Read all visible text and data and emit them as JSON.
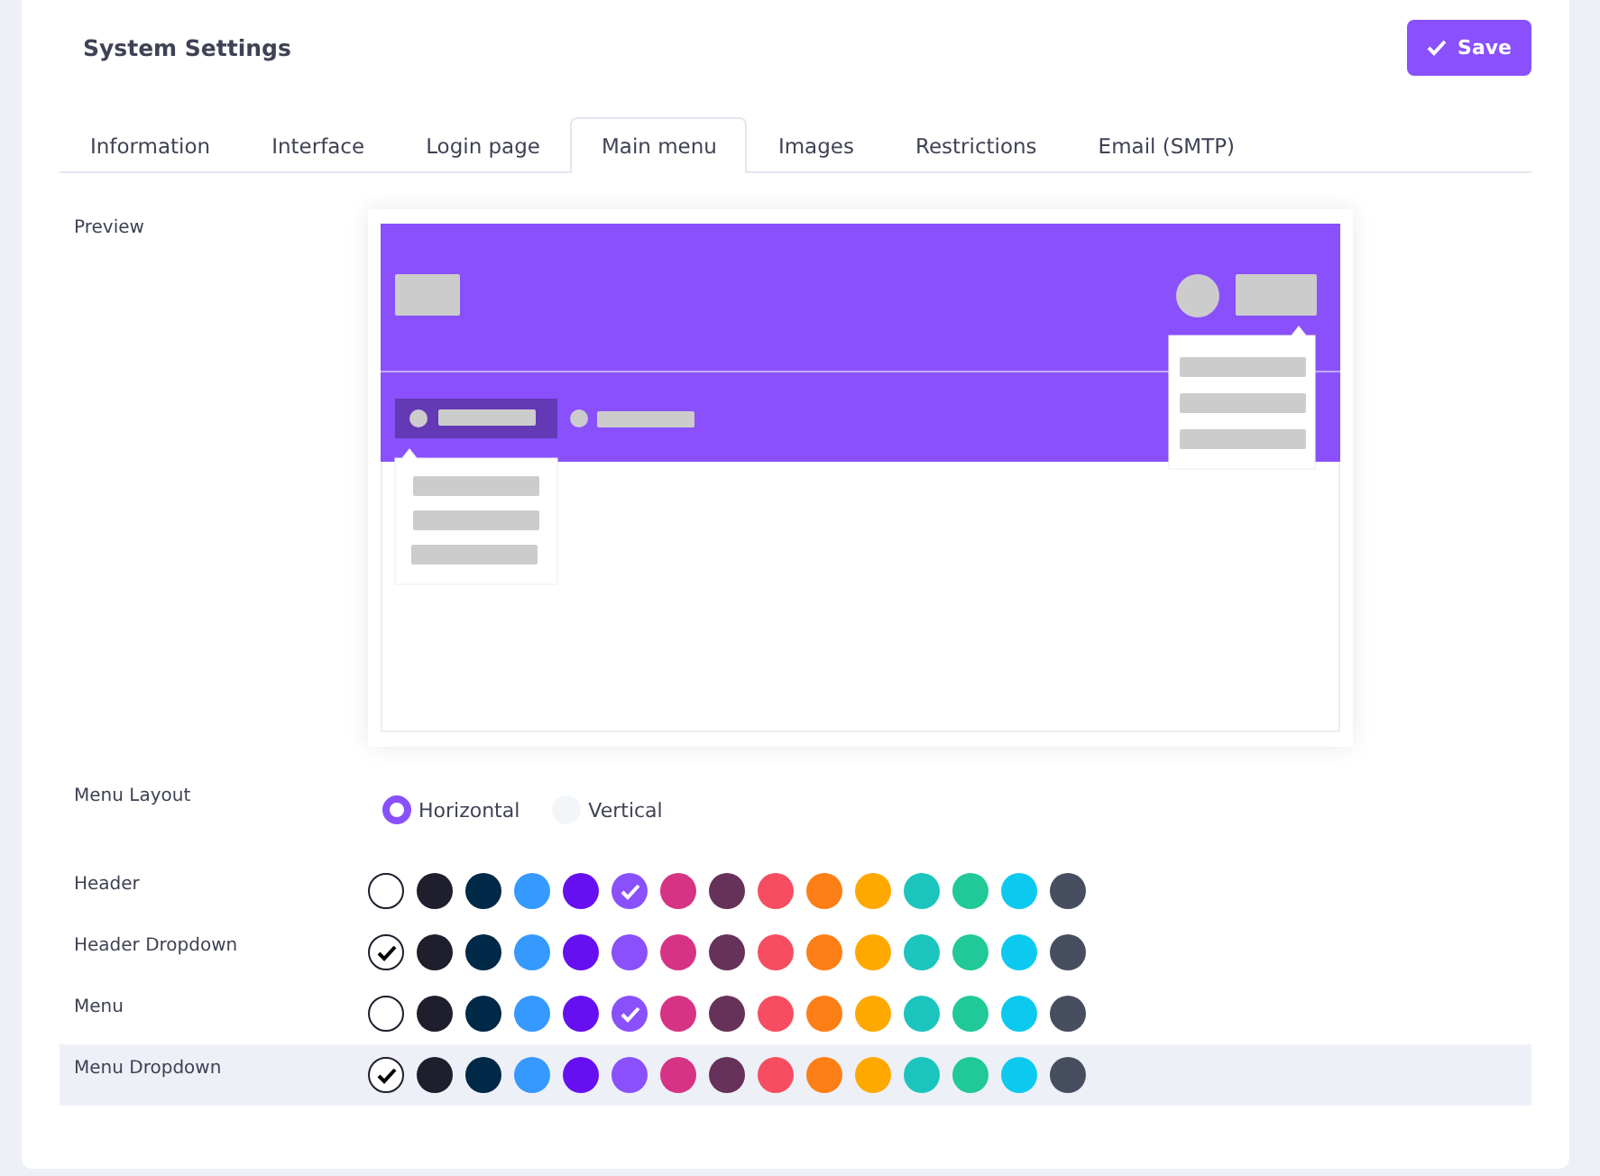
{
  "title": "System Settings",
  "save_button": {
    "label": "Save"
  },
  "tabs": [
    {
      "label": "Information",
      "selected": false
    },
    {
      "label": "Interface",
      "selected": false
    },
    {
      "label": "Login page",
      "selected": false
    },
    {
      "label": "Main menu",
      "selected": true
    },
    {
      "label": "Images",
      "selected": false
    },
    {
      "label": "Restrictions",
      "selected": false
    },
    {
      "label": "Email (SMTP)",
      "selected": false
    }
  ],
  "preview": {
    "label": "Preview"
  },
  "menu_layout": {
    "label": "Menu Layout",
    "options": [
      {
        "label": "Horizontal",
        "selected": true
      },
      {
        "label": "Vertical",
        "selected": false
      }
    ]
  },
  "palettes": [
    {
      "label": "Header",
      "highlighted": false,
      "swatches": [
        {
          "color": "#ffffff",
          "selected": false
        },
        {
          "color": "#1e1e2d",
          "selected": false
        },
        {
          "color": "#002847",
          "selected": false
        },
        {
          "color": "#3699ff",
          "selected": false
        },
        {
          "color": "#6610f2",
          "selected": false
        },
        {
          "color": "#8950fc",
          "selected": true
        },
        {
          "color": "#d63384",
          "selected": false
        },
        {
          "color": "#663259",
          "selected": false
        },
        {
          "color": "#f64e60",
          "selected": false
        },
        {
          "color": "#fd7e14",
          "selected": false
        },
        {
          "color": "#ffa800",
          "selected": false
        },
        {
          "color": "#1bc5bd",
          "selected": false
        },
        {
          "color": "#20c997",
          "selected": false
        },
        {
          "color": "#0bc9ef",
          "selected": false
        },
        {
          "color": "#464e5f",
          "selected": false
        }
      ]
    },
    {
      "label": "Header Dropdown",
      "highlighted": false,
      "swatches": [
        {
          "color": "#ffffff",
          "selected": true
        },
        {
          "color": "#1e1e2d",
          "selected": false
        },
        {
          "color": "#002847",
          "selected": false
        },
        {
          "color": "#3699ff",
          "selected": false
        },
        {
          "color": "#6610f2",
          "selected": false
        },
        {
          "color": "#8950fc",
          "selected": false
        },
        {
          "color": "#d63384",
          "selected": false
        },
        {
          "color": "#663259",
          "selected": false
        },
        {
          "color": "#f64e60",
          "selected": false
        },
        {
          "color": "#fd7e14",
          "selected": false
        },
        {
          "color": "#ffa800",
          "selected": false
        },
        {
          "color": "#1bc5bd",
          "selected": false
        },
        {
          "color": "#20c997",
          "selected": false
        },
        {
          "color": "#0bc9ef",
          "selected": false
        },
        {
          "color": "#464e5f",
          "selected": false
        }
      ]
    },
    {
      "label": "Menu",
      "highlighted": false,
      "swatches": [
        {
          "color": "#ffffff",
          "selected": false
        },
        {
          "color": "#1e1e2d",
          "selected": false
        },
        {
          "color": "#002847",
          "selected": false
        },
        {
          "color": "#3699ff",
          "selected": false
        },
        {
          "color": "#6610f2",
          "selected": false
        },
        {
          "color": "#8950fc",
          "selected": true
        },
        {
          "color": "#d63384",
          "selected": false
        },
        {
          "color": "#663259",
          "selected": false
        },
        {
          "color": "#f64e60",
          "selected": false
        },
        {
          "color": "#fd7e14",
          "selected": false
        },
        {
          "color": "#ffa800",
          "selected": false
        },
        {
          "color": "#1bc5bd",
          "selected": false
        },
        {
          "color": "#20c997",
          "selected": false
        },
        {
          "color": "#0bc9ef",
          "selected": false
        },
        {
          "color": "#464e5f",
          "selected": false
        }
      ]
    },
    {
      "label": "Menu Dropdown",
      "highlighted": true,
      "swatches": [
        {
          "color": "#ffffff",
          "selected": true
        },
        {
          "color": "#1e1e2d",
          "selected": false
        },
        {
          "color": "#002847",
          "selected": false
        },
        {
          "color": "#3699ff",
          "selected": false
        },
        {
          "color": "#6610f2",
          "selected": false
        },
        {
          "color": "#8950fc",
          "selected": false
        },
        {
          "color": "#d63384",
          "selected": false
        },
        {
          "color": "#663259",
          "selected": false
        },
        {
          "color": "#f64e60",
          "selected": false
        },
        {
          "color": "#fd7e14",
          "selected": false
        },
        {
          "color": "#ffa800",
          "selected": false
        },
        {
          "color": "#1bc5bd",
          "selected": false
        },
        {
          "color": "#20c997",
          "selected": false
        },
        {
          "color": "#0bc9ef",
          "selected": false
        },
        {
          "color": "#464e5f",
          "selected": false
        }
      ]
    }
  ]
}
